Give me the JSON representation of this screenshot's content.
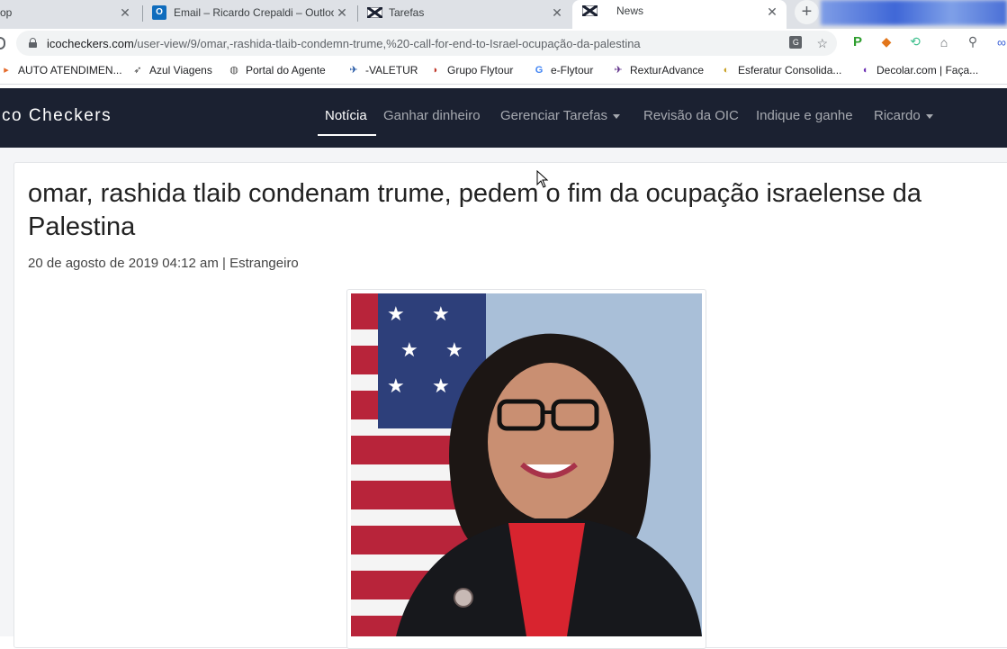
{
  "tabs": [
    {
      "title": "op",
      "active": false
    },
    {
      "title": "Email – Ricardo Crepaldi – Outloo",
      "active": false,
      "icon": "outlook-icon"
    },
    {
      "title": "Tarefas",
      "active": false,
      "icon": "ico-checkers-favicon"
    },
    {
      "title": "News",
      "active": true,
      "icon": "ico-checkers-favicon"
    }
  ],
  "tab_close": "✕",
  "new_tab": "+",
  "address": {
    "domain": "icocheckers.com",
    "path": "/user-view/9/omar,-rashida-tlaib-condemn-trume,%20-call-for-end-to-Israel-ocupação-da-palestina"
  },
  "bookmarks": [
    {
      "label": "AUTO ATENDIMEN...",
      "icon": "page-icon"
    },
    {
      "label": "Azul Viagens",
      "icon": "plane-icon"
    },
    {
      "label": "Portal do Agente",
      "icon": "globe-icon"
    },
    {
      "label": "-VALETUR",
      "icon": "valetur-icon"
    },
    {
      "label": "Grupo Flytour",
      "icon": "flytour-icon"
    },
    {
      "label": "e-Flytour",
      "icon": "google-icon"
    },
    {
      "label": "RexturAdvance",
      "icon": "rextur-icon"
    },
    {
      "label": "Esferatur Consolida...",
      "icon": "esferatur-icon"
    },
    {
      "label": "Decolar.com | Faça...",
      "icon": "decolar-icon"
    }
  ],
  "navbar": {
    "brand": "co Checkers",
    "items": [
      {
        "label": "Notícia",
        "active": true,
        "dropdown": false
      },
      {
        "label": "Ganhar dinheiro",
        "active": false,
        "dropdown": false
      },
      {
        "label": "Gerenciar Tarefas",
        "active": false,
        "dropdown": true
      },
      {
        "label": "Revisão da OIC",
        "active": false,
        "dropdown": false
      },
      {
        "label": "Indique e ganhe",
        "active": false,
        "dropdown": false
      },
      {
        "label": "Ricardo",
        "active": false,
        "dropdown": true
      }
    ]
  },
  "article": {
    "title": "omar, rashida tlaib condenam trume, pedem o fim da ocupação israelense da Palestina",
    "meta": "20 de agosto de 2019 04:12 am | Estrangeiro",
    "image": "portrait-photo"
  },
  "colors": {
    "navbar_bg": "#1b2131",
    "tabstrip_bg": "#dee1e6",
    "page_bg": "#f4f5f7"
  }
}
